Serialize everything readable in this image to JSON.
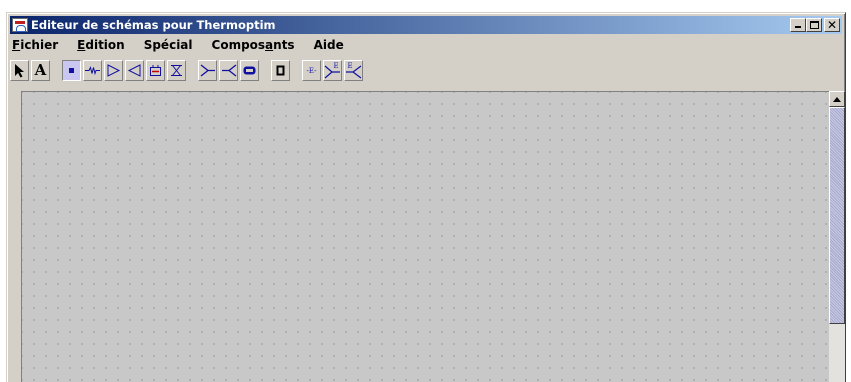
{
  "window": {
    "title": "Editeur de schémas pour Thermoptim",
    "controls": {
      "minimize_icon": "minimize-icon",
      "maximize_icon": "maximize-icon",
      "close_glyph": "✕"
    }
  },
  "menu": [
    {
      "pre": "",
      "mnemonic": "F",
      "post": "ichier"
    },
    {
      "pre": "",
      "mnemonic": "E",
      "post": "dition"
    },
    {
      "pre": "Spécial",
      "mnemonic": "",
      "post": ""
    },
    {
      "pre": "Compos",
      "mnemonic": "a",
      "post": "nts"
    },
    {
      "pre": "Aide",
      "mnemonic": "",
      "post": ""
    }
  ],
  "toolbar": {
    "text_tool_label": "A",
    "tools": [
      "select-arrow-icon",
      "text-tool",
      "point-node-icon",
      "resistor-icon",
      "compressor-icon",
      "turbine-icon",
      "combustion-icon",
      "valve-icon",
      "mixer-icon",
      "divider-icon",
      "heat-exchanger-icon",
      "heat-transfer-icon",
      "external-component-icon",
      "external-mixer-icon",
      "external-divider-icon"
    ],
    "external_labels": {
      "component": "-E-",
      "mixer_sup": "E",
      "divider_sup": "E"
    }
  },
  "colors": {
    "title_start": "#0a246a",
    "title_end": "#a6caf0",
    "chrome": "#d4d0c8",
    "canvas": "#c8c8c8",
    "tool_accent": "#1010a0"
  }
}
